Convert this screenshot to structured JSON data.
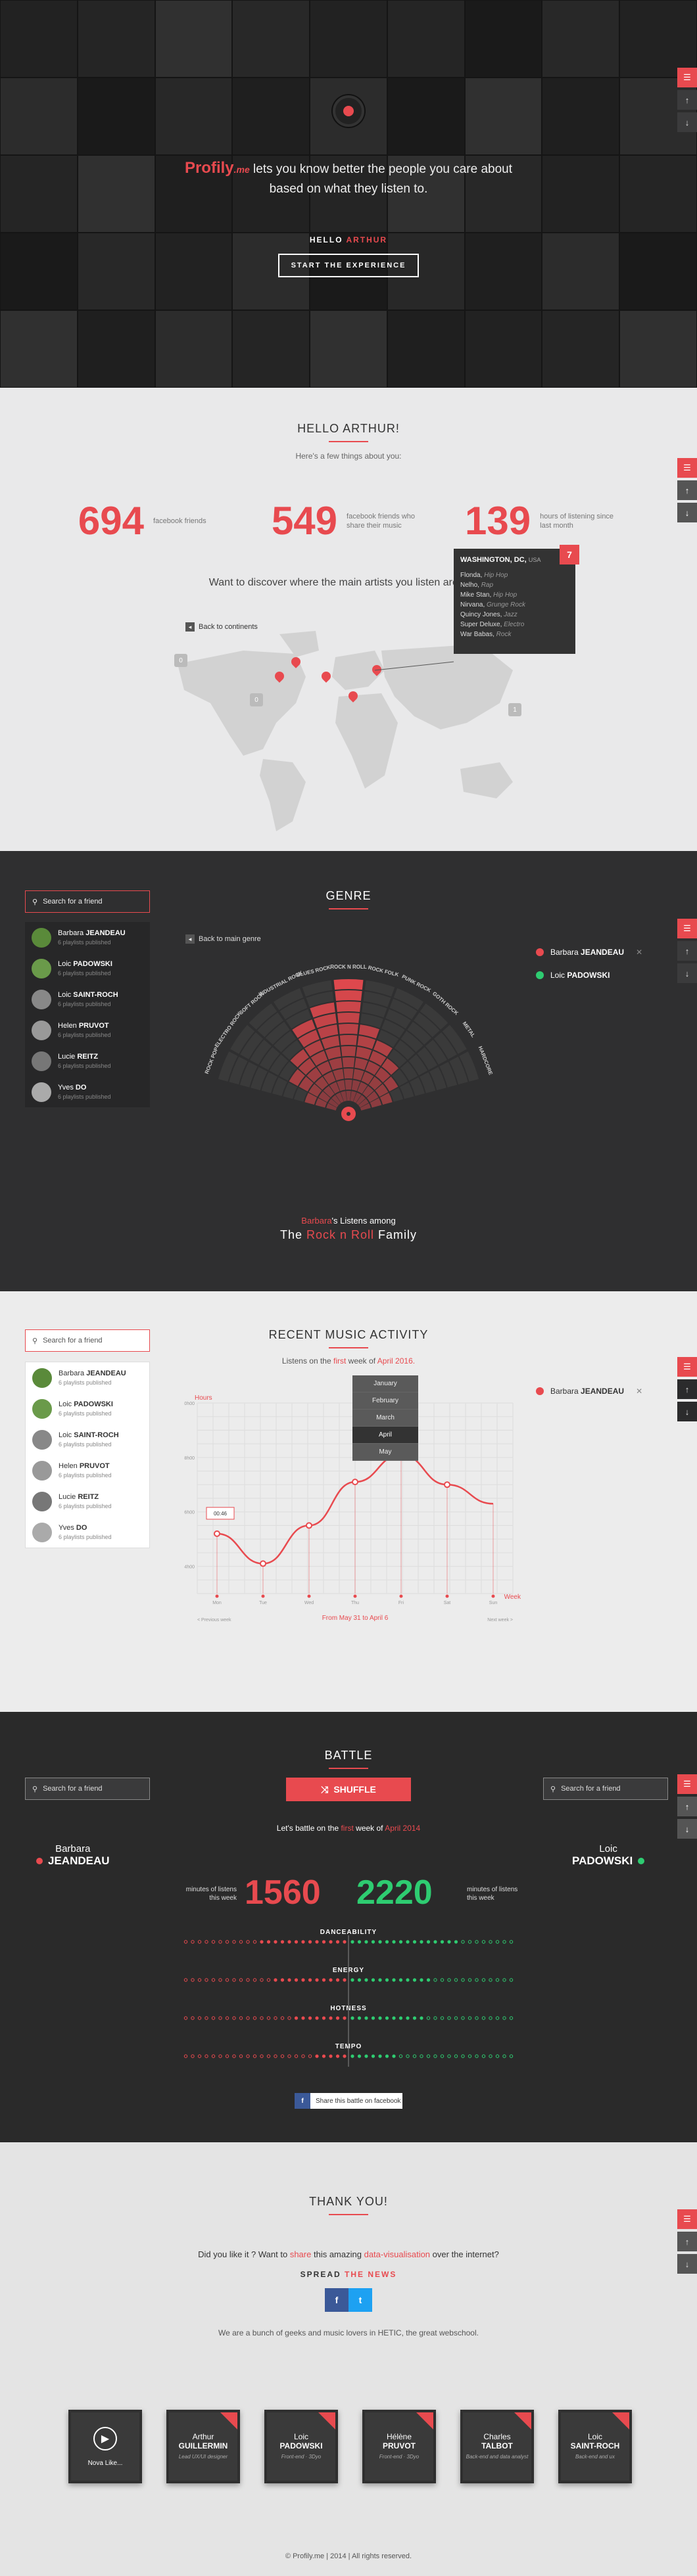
{
  "nav": {
    "menu_icon": "menu-icon",
    "up_icon": "arrow-up-icon",
    "down_icon": "arrow-down-icon"
  },
  "hero": {
    "brand": "Profily",
    "brand_suffix": ".me",
    "tagline_1": "lets you know better the people you care about",
    "tagline_2": "based on what they listen to.",
    "hello_prefix": "HELLO",
    "hello_name": "ARTHUR",
    "cta": "START THE EXPERIENCE"
  },
  "stats": {
    "title": "HELLO ARTHUR!",
    "subtitle": "Here's a few things about you:",
    "items": [
      {
        "num": "694",
        "label": "facebook friends"
      },
      {
        "num": "549",
        "label": "facebook friends who share their music"
      },
      {
        "num": "139",
        "label": "hours of listening since last month"
      }
    ],
    "map_question": "Want to discover where the main artists you listen are from?",
    "back": "Back to continents",
    "country_counts": [
      "0",
      "0",
      "1"
    ],
    "popup": {
      "city": "WASHINGTON, DC",
      "country": "USA",
      "badge": "7",
      "artists": [
        {
          "name": "Flonda,",
          "genre": "Hip Hop"
        },
        {
          "name": "Nelho,",
          "genre": "Rap"
        },
        {
          "name": "Mike Stan,",
          "genre": "Hip Hop"
        },
        {
          "name": "Nirvana,",
          "genre": "Grunge Rock"
        },
        {
          "name": "Quincy Jones,",
          "genre": "Jazz"
        },
        {
          "name": "Super Deluxe,",
          "genre": "Electro"
        },
        {
          "name": "War Babas,",
          "genre": "Rock"
        }
      ]
    }
  },
  "friends": [
    {
      "first": "Barbara",
      "last": "JEANDEAU",
      "pl": "6 playlists published"
    },
    {
      "first": "Loic",
      "last": "PADOWSKI",
      "pl": "6 playlists published"
    },
    {
      "first": "Loic",
      "last": "SAINT-ROCH",
      "pl": "6 playlists published"
    },
    {
      "first": "Helen",
      "last": "PRUVOT",
      "pl": "6 playlists published"
    },
    {
      "first": "Lucie",
      "last": "REITZ",
      "pl": "6 playlists published"
    },
    {
      "first": "Yves",
      "last": "DO",
      "pl": "6 playlists published"
    }
  ],
  "search_placeholder": "Search for a friend",
  "genre": {
    "title": "GENRE",
    "back": "Back to main genre",
    "genres": [
      "ROCK POP",
      "ELECTRO ROCK",
      "SOFT ROCK",
      "INDUSTRIAL ROCK",
      "BLUES ROCK",
      "ROCK N ROLL",
      "ROCK FOLK",
      "PUNK ROCK",
      "GOTH ROCK",
      "METAL",
      "HARDCORE"
    ],
    "legend": [
      {
        "name_first": "Barbara",
        "name_last": "JEANDEAU",
        "color": "#e84a4f"
      },
      {
        "name_first": "Loic",
        "name_last": "PADOWSKI",
        "color": "#2ecc71"
      }
    ],
    "cap_name": "Barbara",
    "cap_mid": "'s Listens among",
    "cap_the": "The",
    "cap_genre": "Rock n Roll",
    "cap_family": "Family",
    "close_icon": "close-icon"
  },
  "activity": {
    "title": "RECENT MUSIC ACTIVITY",
    "sub_1": "Listens on the",
    "sub_first": "first",
    "sub_2": "week of",
    "sub_month": "April 2016.",
    "y_label": "Hours",
    "x_label": "Week",
    "days": [
      "Mon",
      "Tue",
      "Wed",
      "Thu",
      "Fri",
      "Sat",
      "Sun"
    ],
    "range": "From May 31 to April 6",
    "prev": "< Previous week",
    "next": "Next week >",
    "tooltip": "00:46",
    "months": [
      "January",
      "February",
      "March",
      "April",
      "May"
    ],
    "selected_month": "April",
    "legend_first": "Barbara",
    "legend_last": "JEANDEAU",
    "y_ticks": [
      "10h00",
      "08h00",
      "06h00",
      "04h00"
    ]
  },
  "chart_data": {
    "type": "line",
    "categories": [
      "Mon",
      "Tue",
      "Wed",
      "Thu",
      "Fri",
      "Sat",
      "Sun"
    ],
    "series": [
      {
        "values": [
          5.2,
          4.1,
          5.5,
          7.1,
          8.1,
          7.0,
          6.3
        ]
      }
    ],
    "ylabel": "Hours",
    "xlabel": "Week"
  },
  "battle": {
    "title": "BATTLE",
    "shuffle": "SHUFFLE",
    "sub_1": "Let's battle on the",
    "sub_first": "first",
    "sub_2": "week of",
    "sub_month": "April 2014",
    "left_first": "Barbara",
    "left_last": "JEANDEAU",
    "right_first": "Loic",
    "right_last": "PADOWSKI",
    "left_num": "1560",
    "right_num": "2220",
    "min_label": "minutes of listens this week",
    "categories": [
      "DANCEABILITY",
      "ENERGY",
      "HOTNESS",
      "TEMPO"
    ],
    "left_scores": [
      0.55,
      0.45,
      0.35,
      0.2
    ],
    "right_scores": [
      0.65,
      0.5,
      0.45,
      0.3
    ],
    "share": "Share this battle on facebook"
  },
  "thanks": {
    "title": "THANK YOU!",
    "q_1": "Did you like it ? Want to",
    "q_share": "share",
    "q_2": "this amazing",
    "q_data": "data-visualisation",
    "q_3": "over the internet?",
    "spread_1": "SPREAD",
    "spread_2": "THE NEWS",
    "fb": "f",
    "tw": "t",
    "about": "We are a bunch of geeks and music lovers in HETIC, the great webschool.",
    "team": [
      {
        "first": "Nova",
        "last": "Like...",
        "role": ""
      },
      {
        "first": "Arthur",
        "last": "GUILLERMIN",
        "role": "Lead UX/UI designer"
      },
      {
        "first": "Loic",
        "last": "PADOWSKI",
        "role": "Front-end · 3Dyo"
      },
      {
        "first": "Hélène",
        "last": "PRUVOT",
        "role": "Front-end · 3Dyo"
      },
      {
        "first": "Charles",
        "last": "TALBOT",
        "role": "Back-end and data analyst"
      },
      {
        "first": "Loic",
        "last": "SAINT-ROCH",
        "role": "Back-end and ux"
      }
    ],
    "footer": "© Profily.me | 2014 | All rights reserved."
  }
}
